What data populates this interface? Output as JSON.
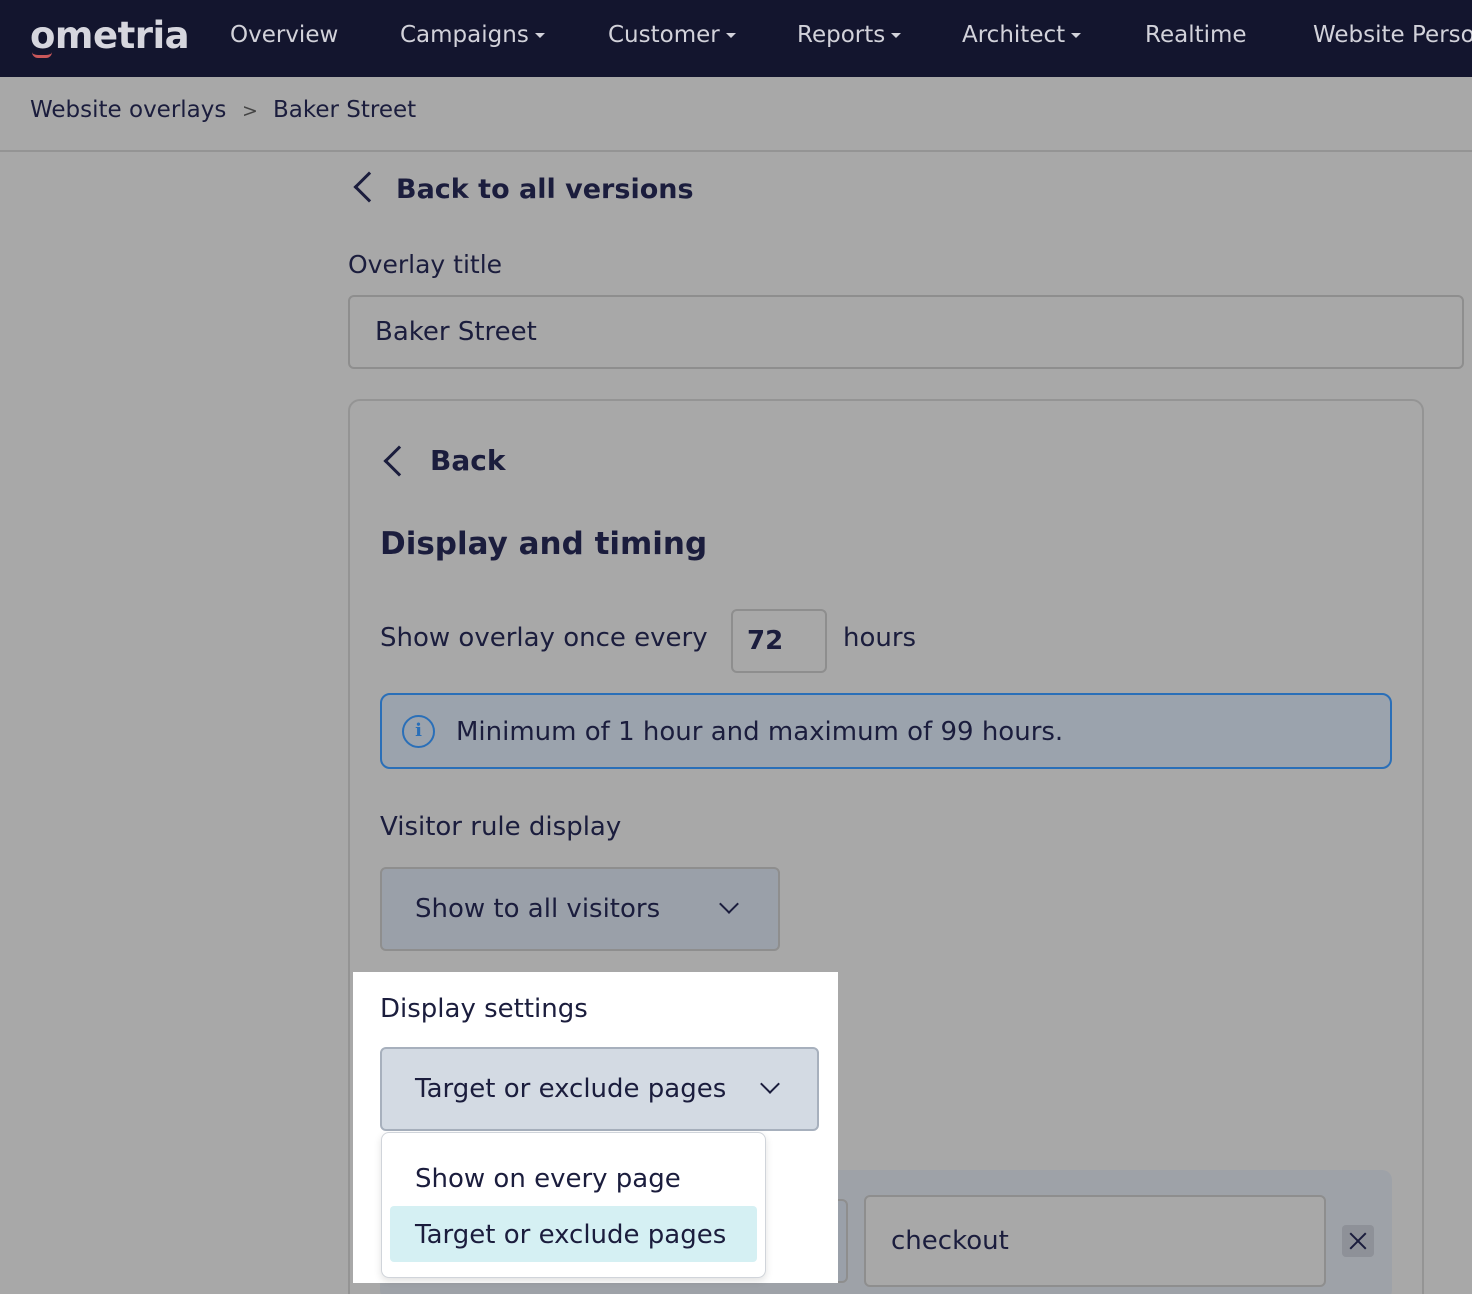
{
  "nav": {
    "logo": "ometria",
    "items": [
      {
        "label": "Overview",
        "has_caret": false
      },
      {
        "label": "Campaigns",
        "has_caret": true
      },
      {
        "label": "Customer",
        "has_caret": true
      },
      {
        "label": "Reports",
        "has_caret": true
      },
      {
        "label": "Architect",
        "has_caret": true
      },
      {
        "label": "Realtime",
        "has_caret": false
      },
      {
        "label": "Website Personalisation",
        "has_caret": false
      }
    ]
  },
  "breadcrumb": {
    "parent": "Website overlays",
    "separator": ">",
    "current": "Baker Street"
  },
  "back_to_versions": "Back to all versions",
  "overlay_title": {
    "label": "Overlay title",
    "value": "Baker Street"
  },
  "panel": {
    "back_label": "Back",
    "heading": "Display and timing",
    "frequency": {
      "prefix": "Show overlay once every",
      "value": "72",
      "unit": "hours"
    },
    "info": {
      "icon": "info-icon",
      "text": "Minimum of 1 hour and maximum of 99 hours."
    },
    "visitor_rule": {
      "label": "Visitor rule display",
      "selected": "Show to all visitors"
    },
    "display_settings": {
      "label": "Display settings",
      "selected": "Target or exclude pages",
      "options": [
        {
          "label": "Show on every page",
          "selected": false
        },
        {
          "label": "Target or exclude pages",
          "selected": true
        }
      ]
    },
    "page_rule": {
      "value": "checkout"
    }
  },
  "colors": {
    "nav_bg": "#13152e",
    "text": "#1b1d3d",
    "info_border": "#2a6fb8",
    "selected_option_bg": "#d5f0f3",
    "overlay_dim": "#a8a8a8",
    "logo_accent": "#c9575a"
  }
}
